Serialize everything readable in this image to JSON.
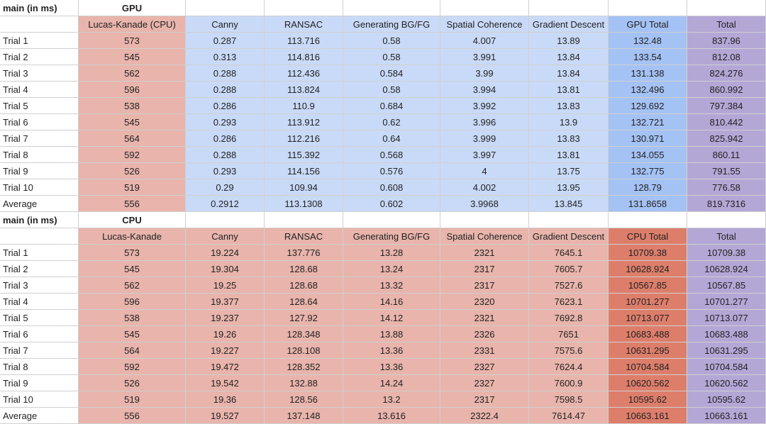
{
  "sheet": {
    "gpu_section": {
      "title_left": "main (in ms)",
      "title_center": "GPU",
      "headers": [
        "",
        "Lucas-Kanade (CPU)",
        "Canny",
        "RANSAC",
        "Generating BG/FG",
        "Spatial Coherence",
        "Gradient Descent",
        "GPU Total",
        "Total"
      ],
      "rows": [
        [
          "Trial 1",
          "573",
          "0.287",
          "113.716",
          "0.58",
          "4.007",
          "13.89",
          "132.48",
          "837.96"
        ],
        [
          "Trial 2",
          "545",
          "0.313",
          "114.816",
          "0.58",
          "3.991",
          "13.84",
          "133.54",
          "812.08"
        ],
        [
          "Trial 3",
          "562",
          "0.288",
          "112.436",
          "0.584",
          "3.99",
          "13.84",
          "131.138",
          "824.276"
        ],
        [
          "Trial 4",
          "596",
          "0.288",
          "113.824",
          "0.58",
          "3.994",
          "13.81",
          "132.496",
          "860.992"
        ],
        [
          "Trial 5",
          "538",
          "0.286",
          "110.9",
          "0.684",
          "3.992",
          "13.83",
          "129.692",
          "797.384"
        ],
        [
          "Trial 6",
          "545",
          "0.293",
          "113.912",
          "0.62",
          "3.996",
          "13.9",
          "132.721",
          "810.442"
        ],
        [
          "Trial 7",
          "564",
          "0.286",
          "112.216",
          "0.64",
          "3.999",
          "13.83",
          "130.971",
          "825.942"
        ],
        [
          "Trial 8",
          "592",
          "0.288",
          "115.392",
          "0.568",
          "3.997",
          "13.81",
          "134.055",
          "860.11"
        ],
        [
          "Trial 9",
          "526",
          "0.293",
          "114.156",
          "0.576",
          "4",
          "13.75",
          "132.775",
          "791.55"
        ],
        [
          "Trial 10",
          "519",
          "0.29",
          "109.94",
          "0.608",
          "4.002",
          "13.95",
          "128.79",
          "776.58"
        ],
        [
          "Average",
          "556",
          "0.2912",
          "113.1308",
          "0.602",
          "3.9968",
          "13.845",
          "131.8658",
          "819.7316"
        ]
      ]
    },
    "cpu_section": {
      "title_left": "main (in ms)",
      "title_center": "CPU",
      "headers": [
        "",
        "Lucas-Kanade",
        "Canny",
        "RANSAC",
        "Generating BG/FG",
        "Spatial Coherence",
        "Gradient Descent",
        "CPU Total",
        "Total"
      ],
      "rows": [
        [
          "Trial 1",
          "573",
          "19.224",
          "137.776",
          "13.28",
          "2321",
          "7645.1",
          "10709.38",
          "10709.38"
        ],
        [
          "Trial 2",
          "545",
          "19.304",
          "128.68",
          "13.24",
          "2317",
          "7605.7",
          "10628.924",
          "10628.924"
        ],
        [
          "Trial 3",
          "562",
          "19.25",
          "128.68",
          "13.32",
          "2317",
          "7527.6",
          "10567.85",
          "10567.85"
        ],
        [
          "Trial 4",
          "596",
          "19.377",
          "128.64",
          "14.16",
          "2320",
          "7623.1",
          "10701.277",
          "10701.277"
        ],
        [
          "Trial 5",
          "538",
          "19.237",
          "127.92",
          "14.12",
          "2321",
          "7692.8",
          "10713.077",
          "10713.077"
        ],
        [
          "Trial 6",
          "545",
          "19.26",
          "128.348",
          "13.88",
          "2326",
          "7651",
          "10683.488",
          "10683.488"
        ],
        [
          "Trial 7",
          "564",
          "19.227",
          "128.108",
          "13.36",
          "2331",
          "7575.6",
          "10631.295",
          "10631.295"
        ],
        [
          "Trial 8",
          "592",
          "19.472",
          "128.352",
          "13.36",
          "2327",
          "7624.4",
          "10704.584",
          "10704.584"
        ],
        [
          "Trial 9",
          "526",
          "19.542",
          "132.88",
          "14.24",
          "2327",
          "7600.9",
          "10620.562",
          "10620.562"
        ],
        [
          "Trial 10",
          "519",
          "19.36",
          "128.56",
          "13.2",
          "2317",
          "7598.5",
          "10595.62",
          "10595.62"
        ],
        [
          "Average",
          "556",
          "19.527",
          "137.148",
          "13.616",
          "2322.4",
          "7614.47",
          "10663.161",
          "10663.161"
        ]
      ]
    },
    "colors": {
      "cpu_column": "#e8b4ab",
      "gpu_column": "#c9daf8",
      "gpu_total": "#a4c2f4",
      "cpu_total": "#dd7e6b",
      "total": "#b4a7d6",
      "gridline": "#d0d0d0"
    }
  }
}
